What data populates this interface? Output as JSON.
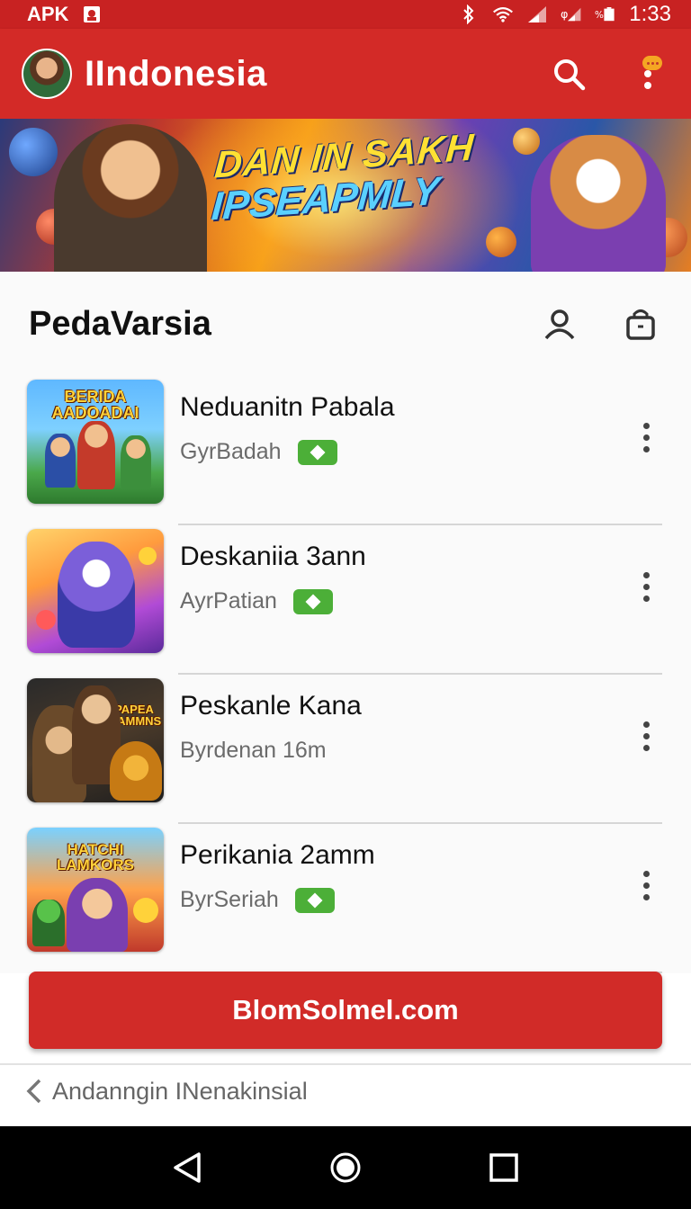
{
  "status_bar": {
    "carrier": "APK",
    "time": "1:33"
  },
  "app_bar": {
    "title": "IIndonesia"
  },
  "banner": {
    "line1": "DAN IN SAKH",
    "line2": "IPSEAPMLY"
  },
  "section": {
    "title": "PedaVarsia"
  },
  "items": [
    {
      "title": "Neduanitn Pabala",
      "subtitle": "GyrBadah",
      "thumb_text": "BERIDA AADOADAI",
      "has_badge": true
    },
    {
      "title": "Deskaniia 3ann",
      "subtitle": "AyrPatian",
      "thumb_text": "",
      "has_badge": true
    },
    {
      "title": "Peskanle Kana",
      "subtitle": "Byrdenan 16m",
      "thumb_text": "PAPEA GAMMNS",
      "has_badge": false
    },
    {
      "title": "Perikania 2amm",
      "subtitle": "ByrSeriah",
      "thumb_text": "HATCHI LAMKORS",
      "has_badge": true
    }
  ],
  "cta": {
    "label": "BlomSolmel.com"
  },
  "footer": {
    "back_label": "Andanngin INenakinsial"
  },
  "colors": {
    "primary": "#d32a27",
    "badge": "#4caf38"
  }
}
